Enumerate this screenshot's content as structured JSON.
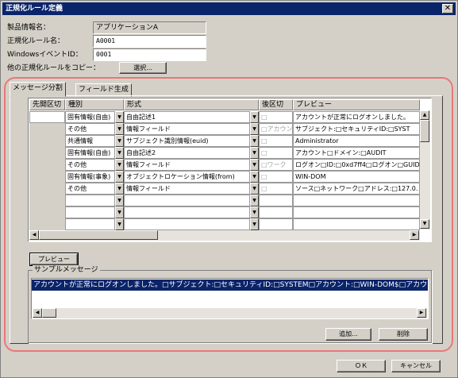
{
  "window": {
    "title": "正規化ルール定義",
    "close": "✕"
  },
  "form": {
    "product_label": "製品情報名：",
    "product_value": "アプリケーションA",
    "rule_label": "正規化ルール名：",
    "rule_value": "A0001",
    "event_label": "WindowsイベントID：",
    "event_value": "0001",
    "copy_label": "他の正規化ルールをコピー：",
    "select_button": "選択..."
  },
  "tabs": [
    "メッセージ分割",
    "フィールド生成"
  ],
  "grid": {
    "headers": [
      "先開区切",
      "種別",
      "形式",
      "後区切",
      "プレビュー"
    ],
    "rows": [
      {
        "prefix": "",
        "kind": "固有情報(自由)",
        "format": "自由記述1",
        "suffix": "□",
        "preview": "アカウントが正常にログオンしました。"
      },
      {
        "prefix": "",
        "kind": "その他",
        "format": "情報フィールド",
        "suffix": "□アカウン",
        "preview": "サブジェクト:□セキュリティID:□SYST"
      },
      {
        "prefix": "",
        "kind": "共通情報",
        "format": "サブジェクト識別情報(euid)",
        "suffix": "□",
        "preview": "Administrator"
      },
      {
        "prefix": "",
        "kind": "固有情報(自由)",
        "format": "自由記述2",
        "suffix": "□",
        "preview": "アカウント□ドメイン:□AUDIT"
      },
      {
        "prefix": "",
        "kind": "その他",
        "format": "情報フィールド",
        "suffix": "□ワーク",
        "preview": "ログオン□ID:□0xd7ff4□ログオン□GUID:"
      },
      {
        "prefix": "",
        "kind": "固有情報(事象)",
        "format": "オブジェクトロケーション情報(from)",
        "suffix": "□",
        "preview": "WIN-DOM"
      },
      {
        "prefix": "",
        "kind": "その他",
        "format": "情報フィールド",
        "suffix": "□",
        "preview": "ソース□ネットワーク□アドレス:□127.0."
      },
      {
        "prefix": "",
        "kind": "",
        "format": "",
        "suffix": "",
        "preview": ""
      },
      {
        "prefix": "",
        "kind": "",
        "format": "",
        "suffix": "",
        "preview": ""
      },
      {
        "prefix": "",
        "kind": "",
        "format": "",
        "suffix": "",
        "preview": ""
      }
    ]
  },
  "preview_button": "プレビュー",
  "sample": {
    "title": "サンプルメッセージ",
    "text": "アカウントが正常にログオンしました。□サブジェクト:□セキュリティID:□SYSTEM□アカウント:□WIN-DOM$□アカウント□ドメ"
  },
  "buttons": {
    "add": "追加...",
    "delete": "削除",
    "ok": "ＯＫ",
    "cancel": "キャンセル"
  },
  "colors": {
    "titlebar": "#0a246a",
    "face": "#d4d0c8",
    "highlight_frame": "#e87878"
  }
}
